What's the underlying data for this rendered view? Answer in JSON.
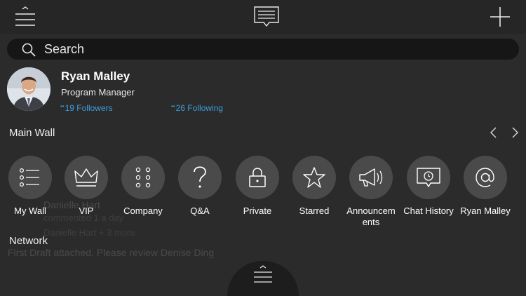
{
  "search": {
    "placeholder": "Search"
  },
  "profile": {
    "name": "Ryan Malley",
    "title": "Program Manager",
    "followers": "19 Followers",
    "following": "26 Following"
  },
  "wall": {
    "title": "Main Wall"
  },
  "categories": [
    {
      "label": "My Wall",
      "icon": "list-icon"
    },
    {
      "label": "VIP",
      "icon": "crown-icon"
    },
    {
      "label": "Company",
      "icon": "grid-dots-icon"
    },
    {
      "label": "Q&A",
      "icon": "question-icon"
    },
    {
      "label": "Private",
      "icon": "lock-icon"
    },
    {
      "label": "Starred",
      "icon": "star-icon"
    },
    {
      "label": "Announcem ents",
      "icon": "megaphone-icon"
    },
    {
      "label": "Chat History",
      "icon": "chat-history-icon"
    },
    {
      "label": "Ryan Malley",
      "icon": "at-icon"
    }
  ],
  "network": {
    "title": "Network"
  },
  "background_feed": {
    "author": "Danielle Hart",
    "meta": "commented 1 a day",
    "line2": "Danielle Hart + 3 more",
    "post": "First Draft attached. Please review Denise Ding"
  },
  "colors": {
    "accent": "#3b9ddb",
    "background": "#2b2b2b",
    "topbar": "#262626",
    "circle": "#4a4a4a"
  }
}
